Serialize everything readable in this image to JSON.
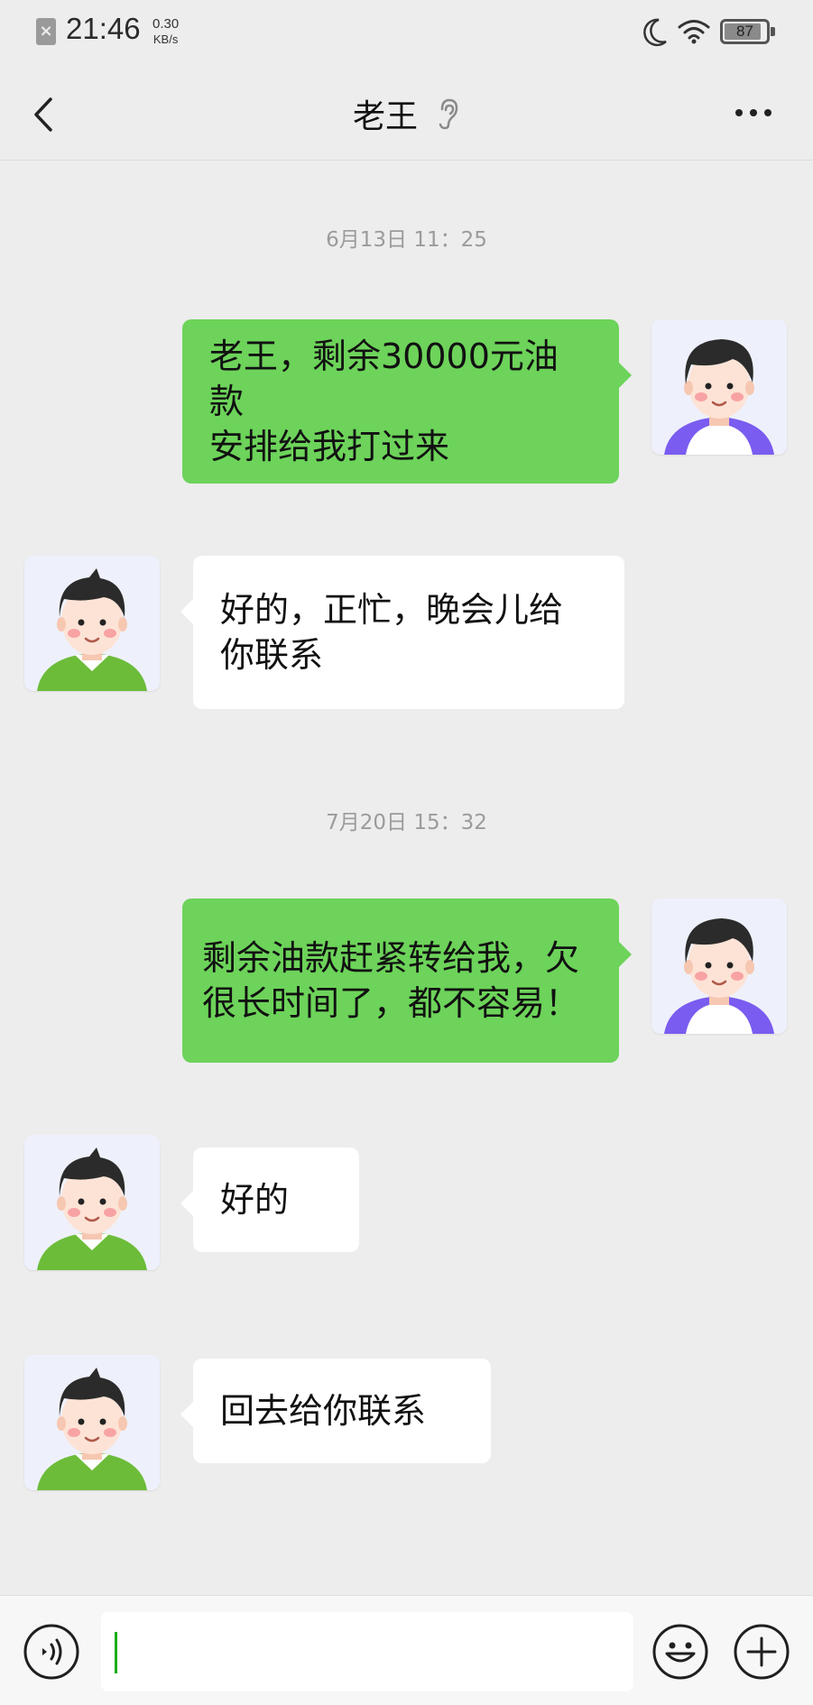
{
  "status_bar": {
    "time": "21:46",
    "speed_value": "0.30",
    "speed_unit": "KB/s",
    "battery": "87",
    "icons": [
      "sim-x-icon",
      "moon-icon",
      "wifi-icon",
      "battery-icon"
    ]
  },
  "nav": {
    "title": "老王",
    "icons": [
      "back-chevron-icon",
      "ear-icon",
      "more-dots-icon"
    ]
  },
  "chat": {
    "timestamp_1": "6月13日 11：25",
    "msg_1": {
      "sender": "me",
      "line1": "老王，剩余30000元油款",
      "line2": "安排给我打过来"
    },
    "msg_2": {
      "sender": "other",
      "line1": "好的，正忙，晚会儿给",
      "line2": "你联系"
    },
    "timestamp_2": "7月20日 15：32",
    "msg_3": {
      "sender": "me",
      "line1": "剩余油款赶紧转给我，欠",
      "line2": "很长时间了，都不容易！"
    },
    "msg_4": {
      "sender": "other",
      "text": "好的"
    },
    "msg_5": {
      "sender": "other",
      "text": "回去给你联系"
    }
  },
  "input_bar": {
    "value": "",
    "icons": [
      "voice-icon",
      "emoji-icon",
      "plus-icon"
    ]
  },
  "colors": {
    "background": "#ededed",
    "my_bubble": "#6dd35a",
    "their_bubble": "#ffffff",
    "timestamp": "#9b9b9b",
    "caret": "#1aad19"
  }
}
